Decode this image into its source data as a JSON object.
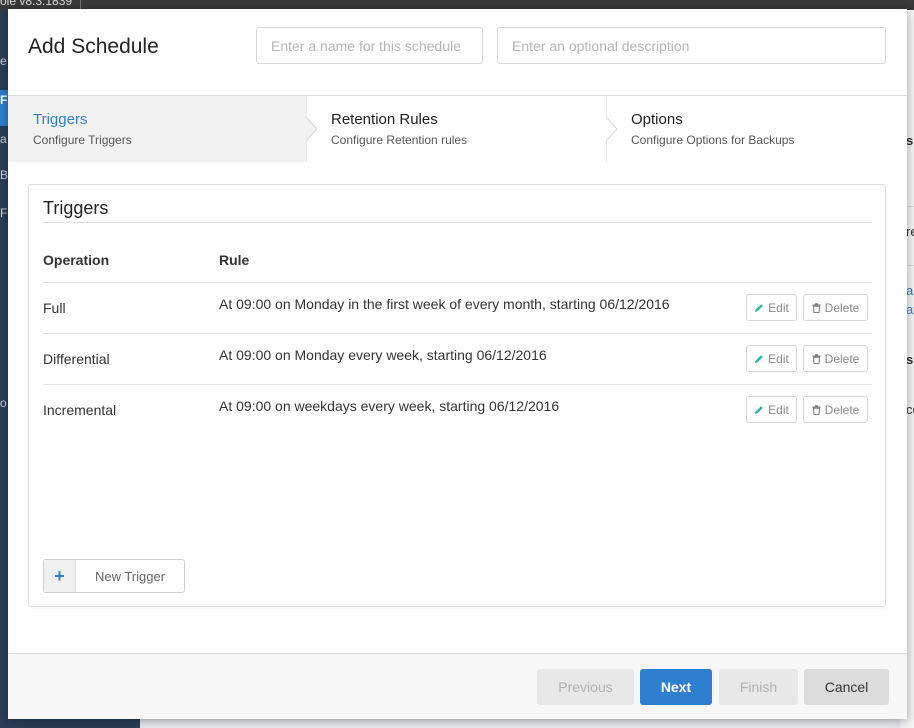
{
  "background": {
    "version_text": "ole   v8.3.1839",
    "sidebar_letters": [
      "e",
      "F",
      "a",
      "Ba",
      "F",
      "o"
    ],
    "right_letters": [
      "s",
      "re",
      "an",
      "at",
      "s",
      "co"
    ]
  },
  "modal": {
    "title": "Add Schedule",
    "name_placeholder": "Enter a name for this schedule",
    "description_placeholder": "Enter an optional description"
  },
  "steps": [
    {
      "title": "Triggers",
      "subtitle": "Configure Triggers",
      "active": true
    },
    {
      "title": "Retention Rules",
      "subtitle": "Configure Retention rules",
      "active": false
    },
    {
      "title": "Options",
      "subtitle": "Configure Options for Backups",
      "active": false
    }
  ],
  "triggers": {
    "title": "Triggers",
    "columns": {
      "operation": "Operation",
      "rule": "Rule"
    },
    "rows": [
      {
        "operation": "Full",
        "rule": "At 09:00 on Monday in the first week of every month, starting 06/12/2016"
      },
      {
        "operation": "Differential",
        "rule": "At 09:00 on Monday every week, starting 06/12/2016"
      },
      {
        "operation": "Incremental",
        "rule": "At 09:00 on weekdays every week, starting 06/12/2016"
      }
    ],
    "edit_label": "Edit",
    "delete_label": "Delete",
    "new_trigger_label": "New Trigger",
    "new_trigger_icon": "+"
  },
  "footer": {
    "previous": "Previous",
    "next": "Next",
    "finish": "Finish",
    "cancel": "Cancel"
  },
  "colors": {
    "accent": "#2f7fd0",
    "sidebar": "#2a3e57"
  }
}
